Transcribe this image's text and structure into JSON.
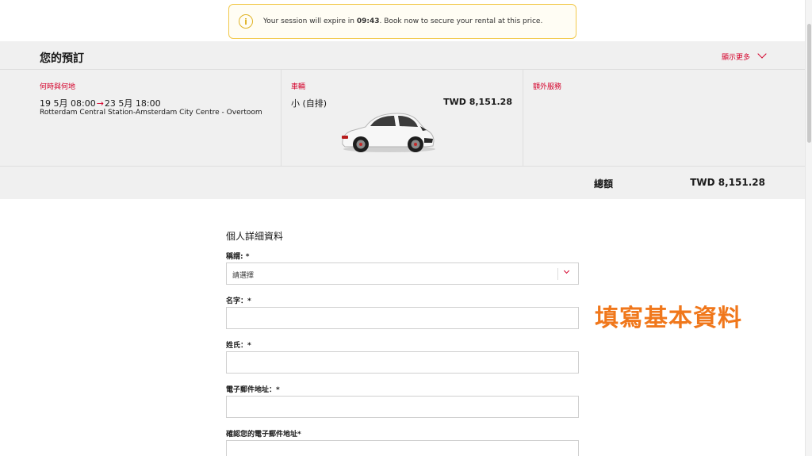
{
  "session": {
    "text_before": "Your session will expire in ",
    "timer": "09:43",
    "text_after": ". Book now to secure your rental at this price."
  },
  "booking": {
    "title": "您的預訂",
    "show_more": "顯示更多",
    "when_where": {
      "label": "何時與何地",
      "pickup": "19 5月 08:00",
      "arrow": "→",
      "dropoff": "23 5月 18:00",
      "location": "Rotterdam Central Station-Amsterdam City Centre - Overtoom"
    },
    "vehicle": {
      "label": "車輛",
      "class": "小 (自排)",
      "price": "TWD 8,151.28"
    },
    "extras": {
      "label": "額外服務"
    },
    "total": {
      "label": "總額",
      "value": "TWD 8,151.28"
    }
  },
  "form": {
    "title": "個人詳細資料",
    "salutation": {
      "label": "稱謂: *",
      "value": "請選擇"
    },
    "first_name": {
      "label": "名字：*",
      "value": ""
    },
    "last_name": {
      "label": "姓氏：*",
      "value": ""
    },
    "email": {
      "label": "電子郵件地址：*",
      "value": ""
    },
    "email_confirm": {
      "label": "確認您的電子郵件地址*",
      "value": ""
    }
  },
  "annotation": "填寫基本資料",
  "colors": {
    "accent": "#d4002a",
    "banner_border": "#f2c94c",
    "annotation": "#f0771b"
  }
}
